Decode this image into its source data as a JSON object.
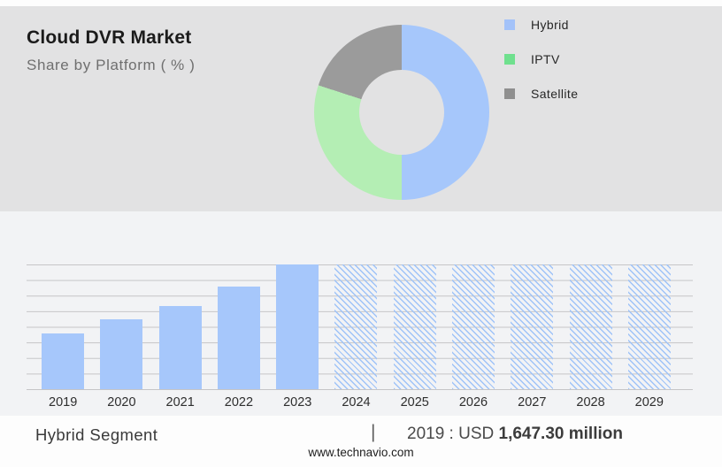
{
  "header": {
    "title": "Cloud DVR Market",
    "subtitle": "Share by Platform ( % )"
  },
  "chart_data": [
    {
      "type": "pie",
      "donut": true,
      "title": "Cloud DVR Market — Share by Platform ( % )",
      "labels": [
        "Hybrid",
        "IPTV",
        "Satellite"
      ],
      "values_pct": [
        50,
        30,
        20
      ],
      "colors": [
        "#a6c7fb",
        "#b4eeb4",
        "#9b9b9b"
      ],
      "legend_colors": [
        "#a3c2f9",
        "#6fe08e",
        "#8f8f8f"
      ],
      "legend_position": "right",
      "start_angle_deg": 0,
      "direction": "clockwise"
    },
    {
      "type": "bar",
      "categories": [
        "2019",
        "2020",
        "2021",
        "2022",
        "2023",
        "2024",
        "2025",
        "2026",
        "2027",
        "2028",
        "2029"
      ],
      "bars": [
        {
          "year": "2019",
          "height_pct": 44.7,
          "style": "solid"
        },
        {
          "year": "2020",
          "height_pct": 56.0,
          "style": "solid"
        },
        {
          "year": "2021",
          "height_pct": 66.7,
          "style": "solid"
        },
        {
          "year": "2022",
          "height_pct": 82.3,
          "style": "solid"
        },
        {
          "year": "2023",
          "height_pct": 100,
          "style": "solid"
        },
        {
          "year": "2024",
          "height_pct": 100,
          "style": "hatched"
        },
        {
          "year": "2025",
          "height_pct": 100,
          "style": "hatched"
        },
        {
          "year": "2026",
          "height_pct": 100,
          "style": "hatched"
        },
        {
          "year": "2027",
          "height_pct": 100,
          "style": "hatched"
        },
        {
          "year": "2028",
          "height_pct": 100,
          "style": "hatched"
        },
        {
          "year": "2029",
          "height_pct": 100,
          "style": "hatched"
        }
      ],
      "historical_years": [
        "2019",
        "2020",
        "2021",
        "2022",
        "2023"
      ],
      "forecast_years_hatched_full_height": [
        "2024",
        "2025",
        "2026",
        "2027",
        "2028",
        "2029"
      ],
      "known_value": {
        "year": "2019",
        "value": "USD 1,647.30 million"
      },
      "bar_color": "#a6c7fb",
      "hatch_color": "#9fc3f8",
      "xlabel": "",
      "ylabel": "",
      "y_axis_tick_labels": "none visible",
      "gridlines_horizontal": 9,
      "grid": true
    }
  ],
  "footnote": {
    "segment_label": "Hybrid Segment",
    "divider": "|",
    "value_prefix": "2019 : USD ",
    "value_bold": "1,647.30 million"
  },
  "footer": {
    "url": "www.technavio.com"
  },
  "colors": {
    "top_section_bg": "#e2e2e3",
    "mid_section_bg": "#f2f3f5",
    "page_bg": "#fdfdfd",
    "gridline": "#c5c5c7",
    "hybrid_blue": "#a6c7fb",
    "iptv_green": "#b4eeb4",
    "satellite_gray": "#9b9b9b"
  }
}
